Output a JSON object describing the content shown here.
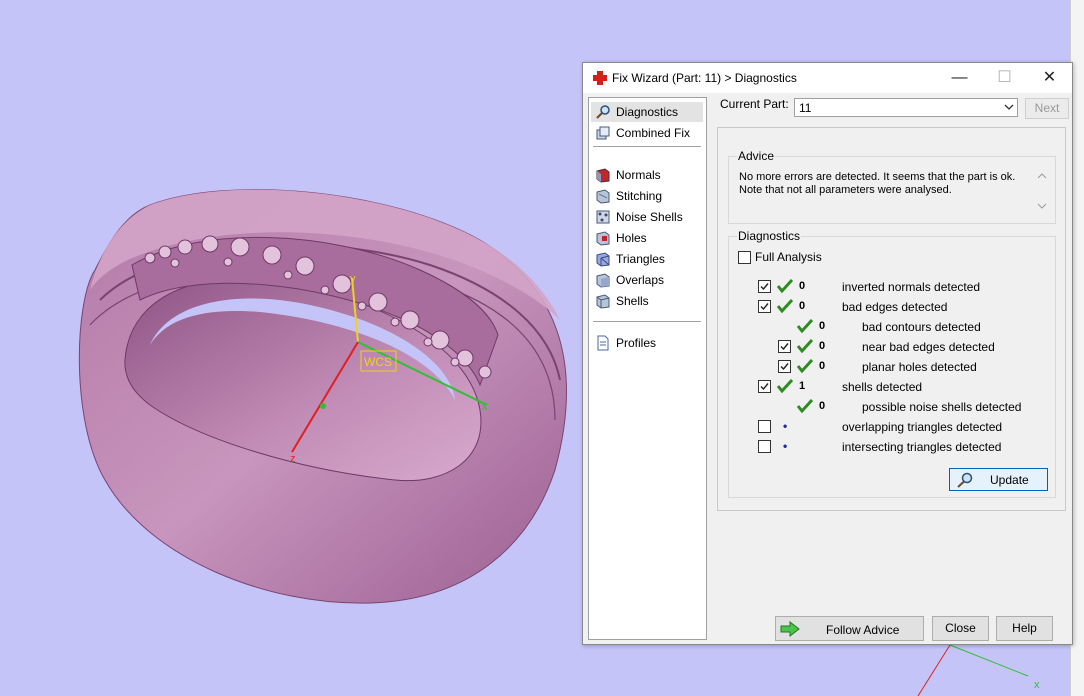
{
  "viewport": {
    "background": "#c4c4f8",
    "axes": {
      "x": "x",
      "y": "y",
      "z": "z",
      "wcs": "WCS"
    }
  },
  "dialog": {
    "title": "Fix Wizard (Part: 11) > Diagnostics",
    "buttons": {
      "minimize": "—",
      "maximize": "☐",
      "close": "✕"
    },
    "nav": [
      {
        "label": "Diagnostics",
        "icon": "magnifier-icon"
      },
      {
        "label": "Combined Fix",
        "icon": "combined-fix-icon"
      },
      {
        "label": "Normals",
        "icon": "normals-icon"
      },
      {
        "label": "Stitching",
        "icon": "stitching-icon"
      },
      {
        "label": "Noise Shells",
        "icon": "noise-shells-icon"
      },
      {
        "label": "Holes",
        "icon": "holes-icon"
      },
      {
        "label": "Triangles",
        "icon": "triangles-icon"
      },
      {
        "label": "Overlaps",
        "icon": "overlaps-icon"
      },
      {
        "label": "Shells",
        "icon": "shells-icon"
      },
      {
        "label": "Profiles",
        "icon": "profiles-icon"
      }
    ],
    "current_part_label": "Current Part:",
    "current_part_value": "11",
    "next_label": "Next",
    "advice": {
      "title": "Advice",
      "line1": "No more errors are detected. It seems that the part is ok.",
      "line2": "Note that not all parameters were analysed."
    },
    "diagnostics": {
      "title": "Diagnostics",
      "full_analysis_label": "Full Analysis",
      "rows": [
        {
          "checked": true,
          "status": "ok",
          "count": "0",
          "label": "inverted normals detected"
        },
        {
          "checked": true,
          "status": "ok",
          "count": "0",
          "label": "bad edges detected"
        },
        {
          "checked": null,
          "status": "ok",
          "count": "0",
          "label": "bad contours detected"
        },
        {
          "checked": true,
          "status": "ok",
          "count": "0",
          "label": "near bad edges detected"
        },
        {
          "checked": true,
          "status": "ok",
          "count": "0",
          "label": "planar holes detected"
        },
        {
          "checked": true,
          "status": "ok",
          "count": "1",
          "label": "shells detected"
        },
        {
          "checked": null,
          "status": "ok",
          "count": "0",
          "label": "possible noise shells detected"
        },
        {
          "checked": false,
          "status": "pending",
          "count": "•",
          "label": "overlapping triangles detected"
        },
        {
          "checked": false,
          "status": "pending",
          "count": "•",
          "label": "intersecting triangles detected"
        }
      ],
      "update_label": "Update"
    },
    "footer": {
      "follow_advice_label": "Follow Advice",
      "close_label": "Close",
      "help_label": "Help"
    }
  },
  "colors": {
    "ok": "#2e8b1f",
    "ring": "#c48ab8",
    "accent": "#d4201a"
  }
}
